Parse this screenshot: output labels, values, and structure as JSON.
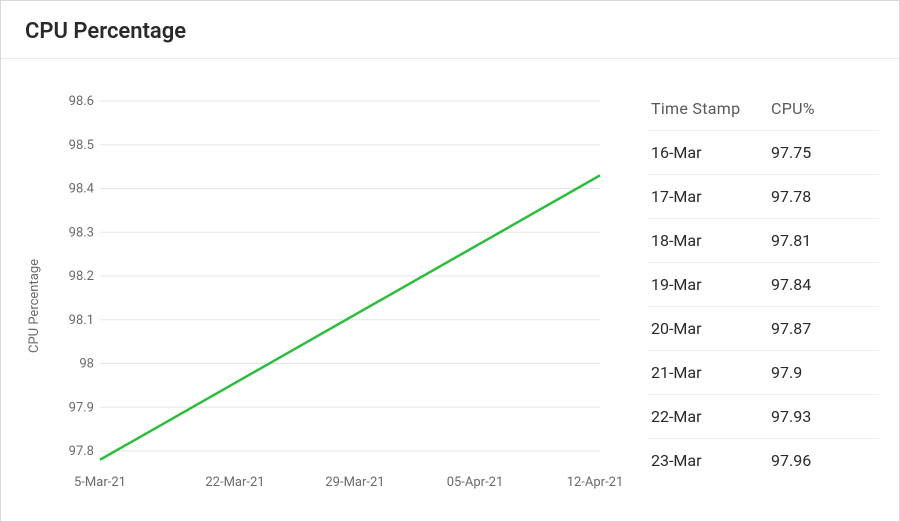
{
  "title": "CPU Percentage",
  "yaxis_title": "CPU Percentage",
  "y_ticks": [
    "97.8",
    "97.9",
    "98",
    "98.1",
    "98.2",
    "98.3",
    "98.4",
    "98.5",
    "98.6"
  ],
  "x_ticks": [
    "5-Mar-21",
    "22-Mar-21",
    "29-Mar-21",
    "05-Apr-21",
    "12-Apr-21"
  ],
  "table": {
    "header_ts": "Time Stamp",
    "header_cpu": "CPU%",
    "rows": [
      {
        "ts": "16-Mar",
        "cpu": "97.75"
      },
      {
        "ts": "17-Mar",
        "cpu": "97.78"
      },
      {
        "ts": "18-Mar",
        "cpu": "97.81"
      },
      {
        "ts": "19-Mar",
        "cpu": "97.84"
      },
      {
        "ts": "20-Mar",
        "cpu": "97.87"
      },
      {
        "ts": "21-Mar",
        "cpu": "97.9"
      },
      {
        "ts": "22-Mar",
        "cpu": "97.93"
      },
      {
        "ts": "23-Mar",
        "cpu": "97.96"
      }
    ]
  },
  "chart_data": {
    "type": "line",
    "title": "CPU Percentage",
    "xlabel": "",
    "ylabel": "CPU Percentage",
    "ylim": [
      97.8,
      98.6
    ],
    "x": [
      "5-Mar-21",
      "22-Mar-21",
      "29-Mar-21",
      "05-Apr-21",
      "12-Apr-21"
    ],
    "series": [
      {
        "name": "CPU%",
        "values": [
          97.78,
          98.05,
          98.17,
          98.29,
          98.43
        ]
      }
    ]
  }
}
